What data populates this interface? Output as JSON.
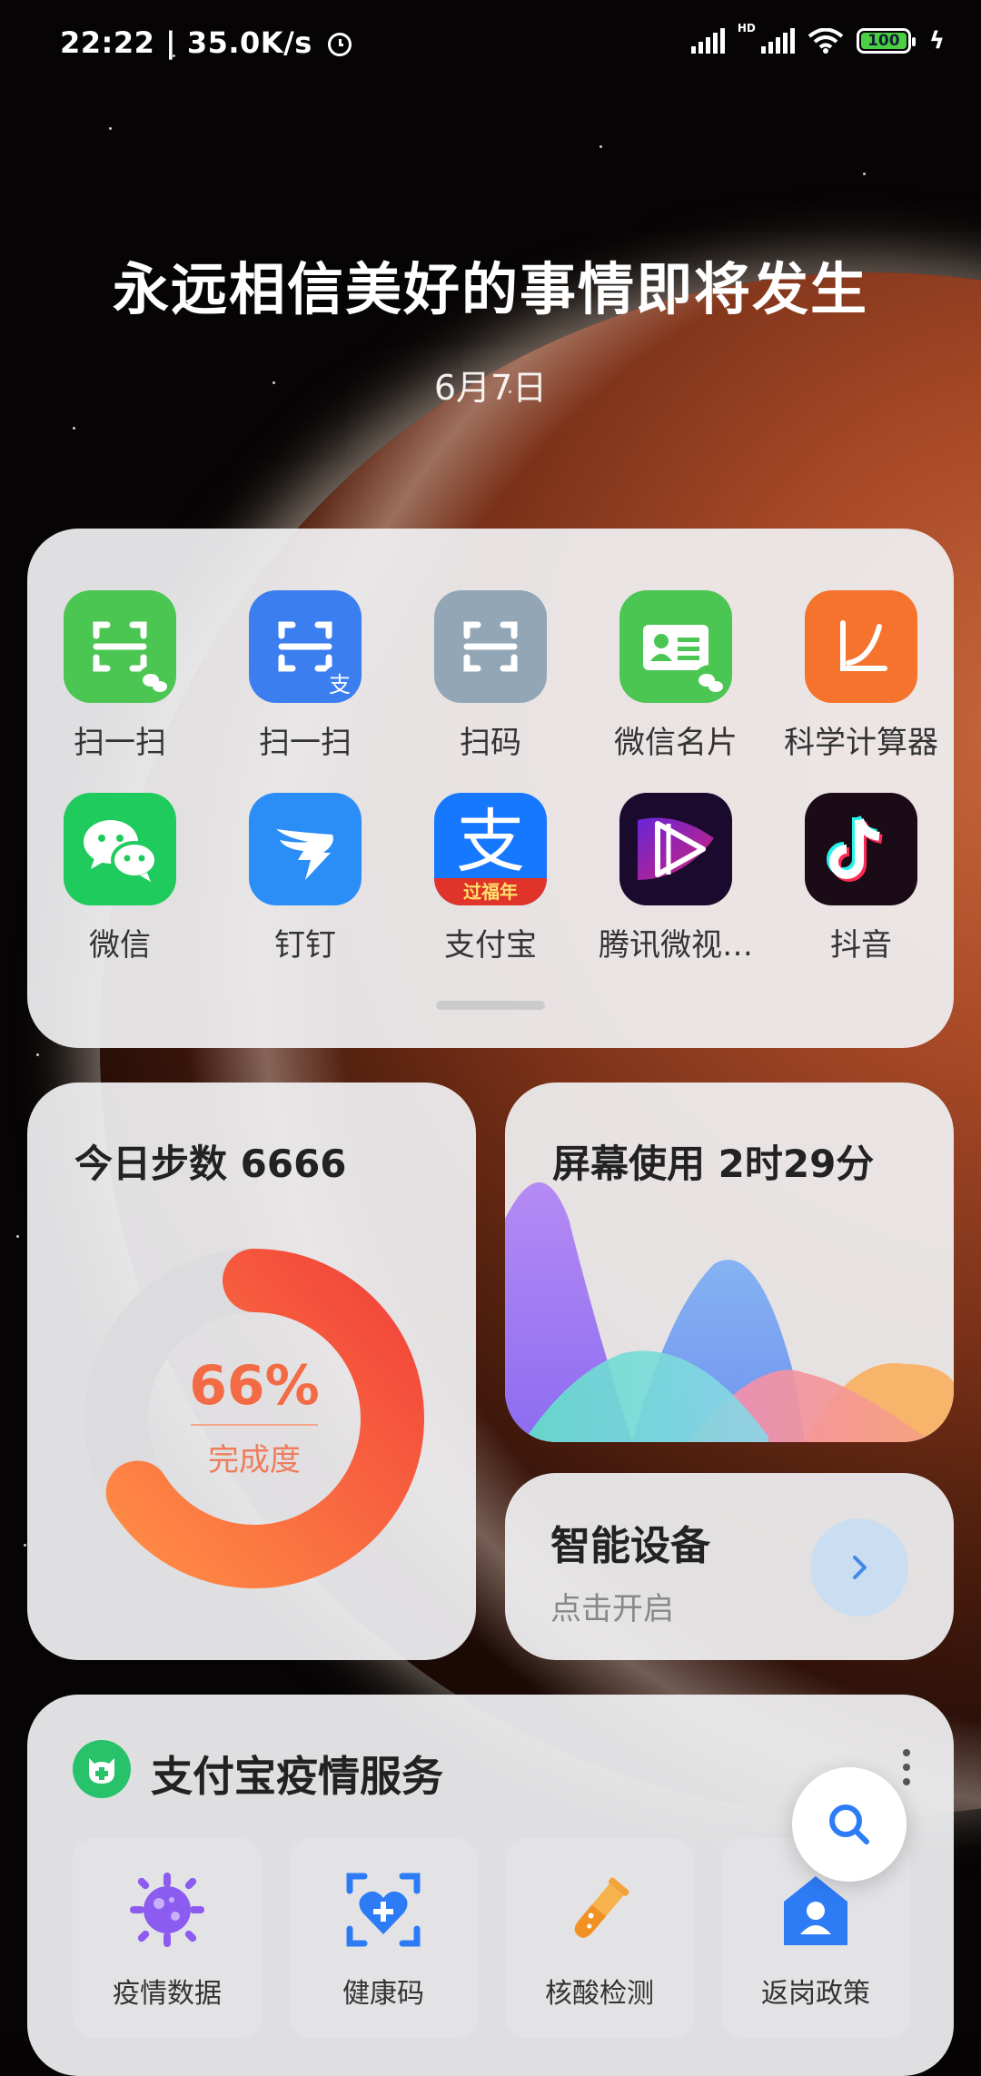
{
  "status_bar": {
    "time": "22:22 | 35.0K/s",
    "hd_label": "HD",
    "battery": "100"
  },
  "header": {
    "motto": "永远相信美好的事情即将发生",
    "date": "6月7日"
  },
  "app_shortcuts": [
    {
      "label": "扫一扫",
      "icon": "wechat-scan-icon",
      "color": "#4bc653"
    },
    {
      "label": "扫一扫",
      "icon": "alipay-scan-icon",
      "color": "#3b7ef0"
    },
    {
      "label": "扫码",
      "icon": "scan-code-icon",
      "color": "#93a6b5"
    },
    {
      "label": "微信名片",
      "icon": "wechat-card-icon",
      "color": "#4bc653"
    },
    {
      "label": "科学计算器",
      "icon": "calculator-icon",
      "color": "#f5732d"
    },
    {
      "label": "微信",
      "icon": "wechat-icon",
      "color": "#1fcb5c"
    },
    {
      "label": "钉钉",
      "icon": "dingtalk-icon",
      "color": "#2b8ef6"
    },
    {
      "label": "支付宝",
      "icon": "alipay-icon",
      "color": "#1677ff",
      "badge": "过福年"
    },
    {
      "label": "腾讯微视…",
      "icon": "weishi-icon",
      "color": "#1a0b2e"
    },
    {
      "label": "抖音",
      "icon": "douyin-icon",
      "color": "#1a0b16"
    }
  ],
  "steps": {
    "title": "今日步数 6666",
    "percent_text": "66%",
    "percent_value": 0.66,
    "label": "完成度",
    "ring_color_start": "#ff7d45",
    "ring_color_end": "#f24b3a"
  },
  "screen_time": {
    "title": "屏幕使用 2时29分"
  },
  "smart_device": {
    "title": "智能设备",
    "subtitle": "点击开启"
  },
  "alipay_service": {
    "title": "支付宝疫情服务",
    "items": [
      {
        "label": "疫情数据",
        "icon": "virus-icon"
      },
      {
        "label": "健康码",
        "icon": "health-code-icon"
      },
      {
        "label": "核酸检测",
        "icon": "test-tube-icon"
      },
      {
        "label": "返岗政策",
        "icon": "return-policy-icon"
      }
    ]
  }
}
